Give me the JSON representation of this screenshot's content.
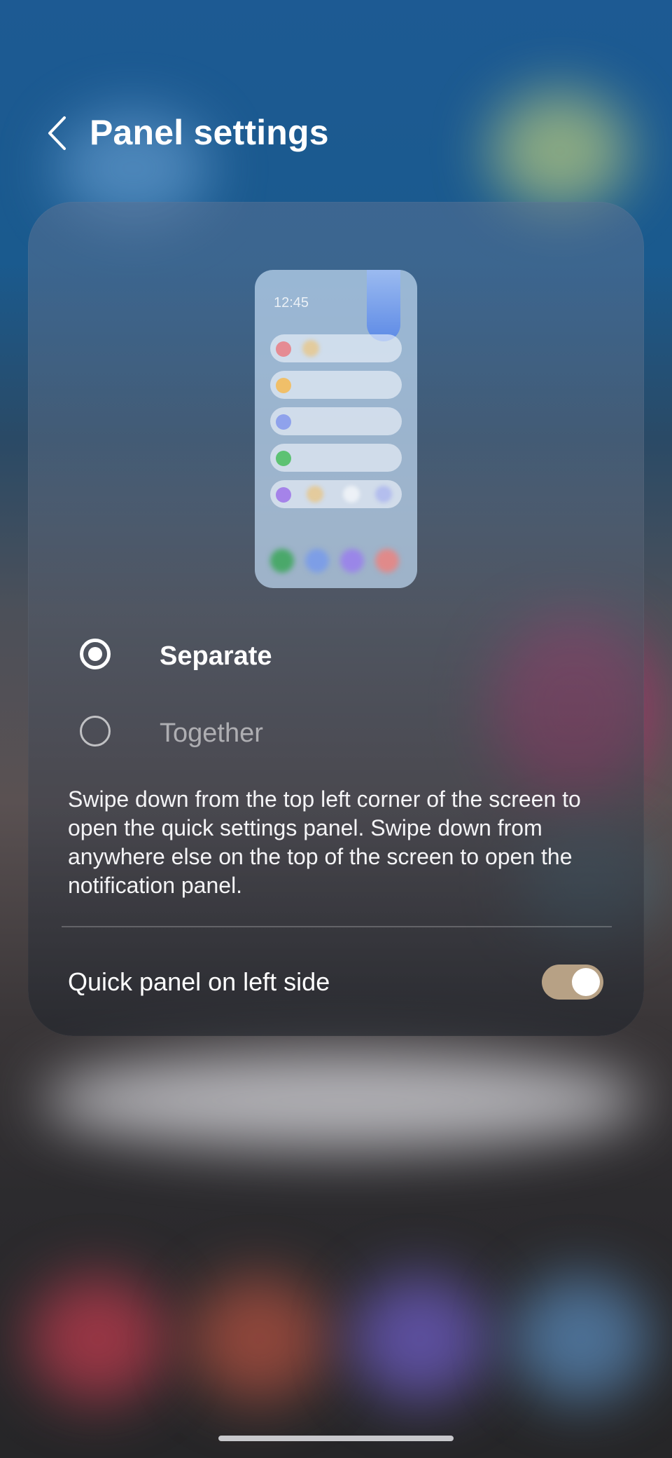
{
  "header": {
    "back_icon": "chevron-left-icon",
    "title": "Panel settings"
  },
  "preview": {
    "time": "12:45",
    "row_dot_colors": [
      "#e58b93",
      "#f0bf69",
      "#8fa2ec",
      "#5dc273",
      "#a583e9"
    ],
    "dock_colors": [
      "#4aa86a",
      "#7d9ee6",
      "#9a86e8",
      "#e08a8a"
    ]
  },
  "options": [
    {
      "label": "Separate",
      "selected": true
    },
    {
      "label": "Together",
      "selected": false
    }
  ],
  "description": "Swipe down from the top left corner of the screen to open the quick settings panel. Swipe down from anywhere else on the top of the screen to open the notification panel.",
  "quick_panel_toggle": {
    "label": "Quick panel on left side",
    "on": true,
    "accent": "#b7a185"
  }
}
